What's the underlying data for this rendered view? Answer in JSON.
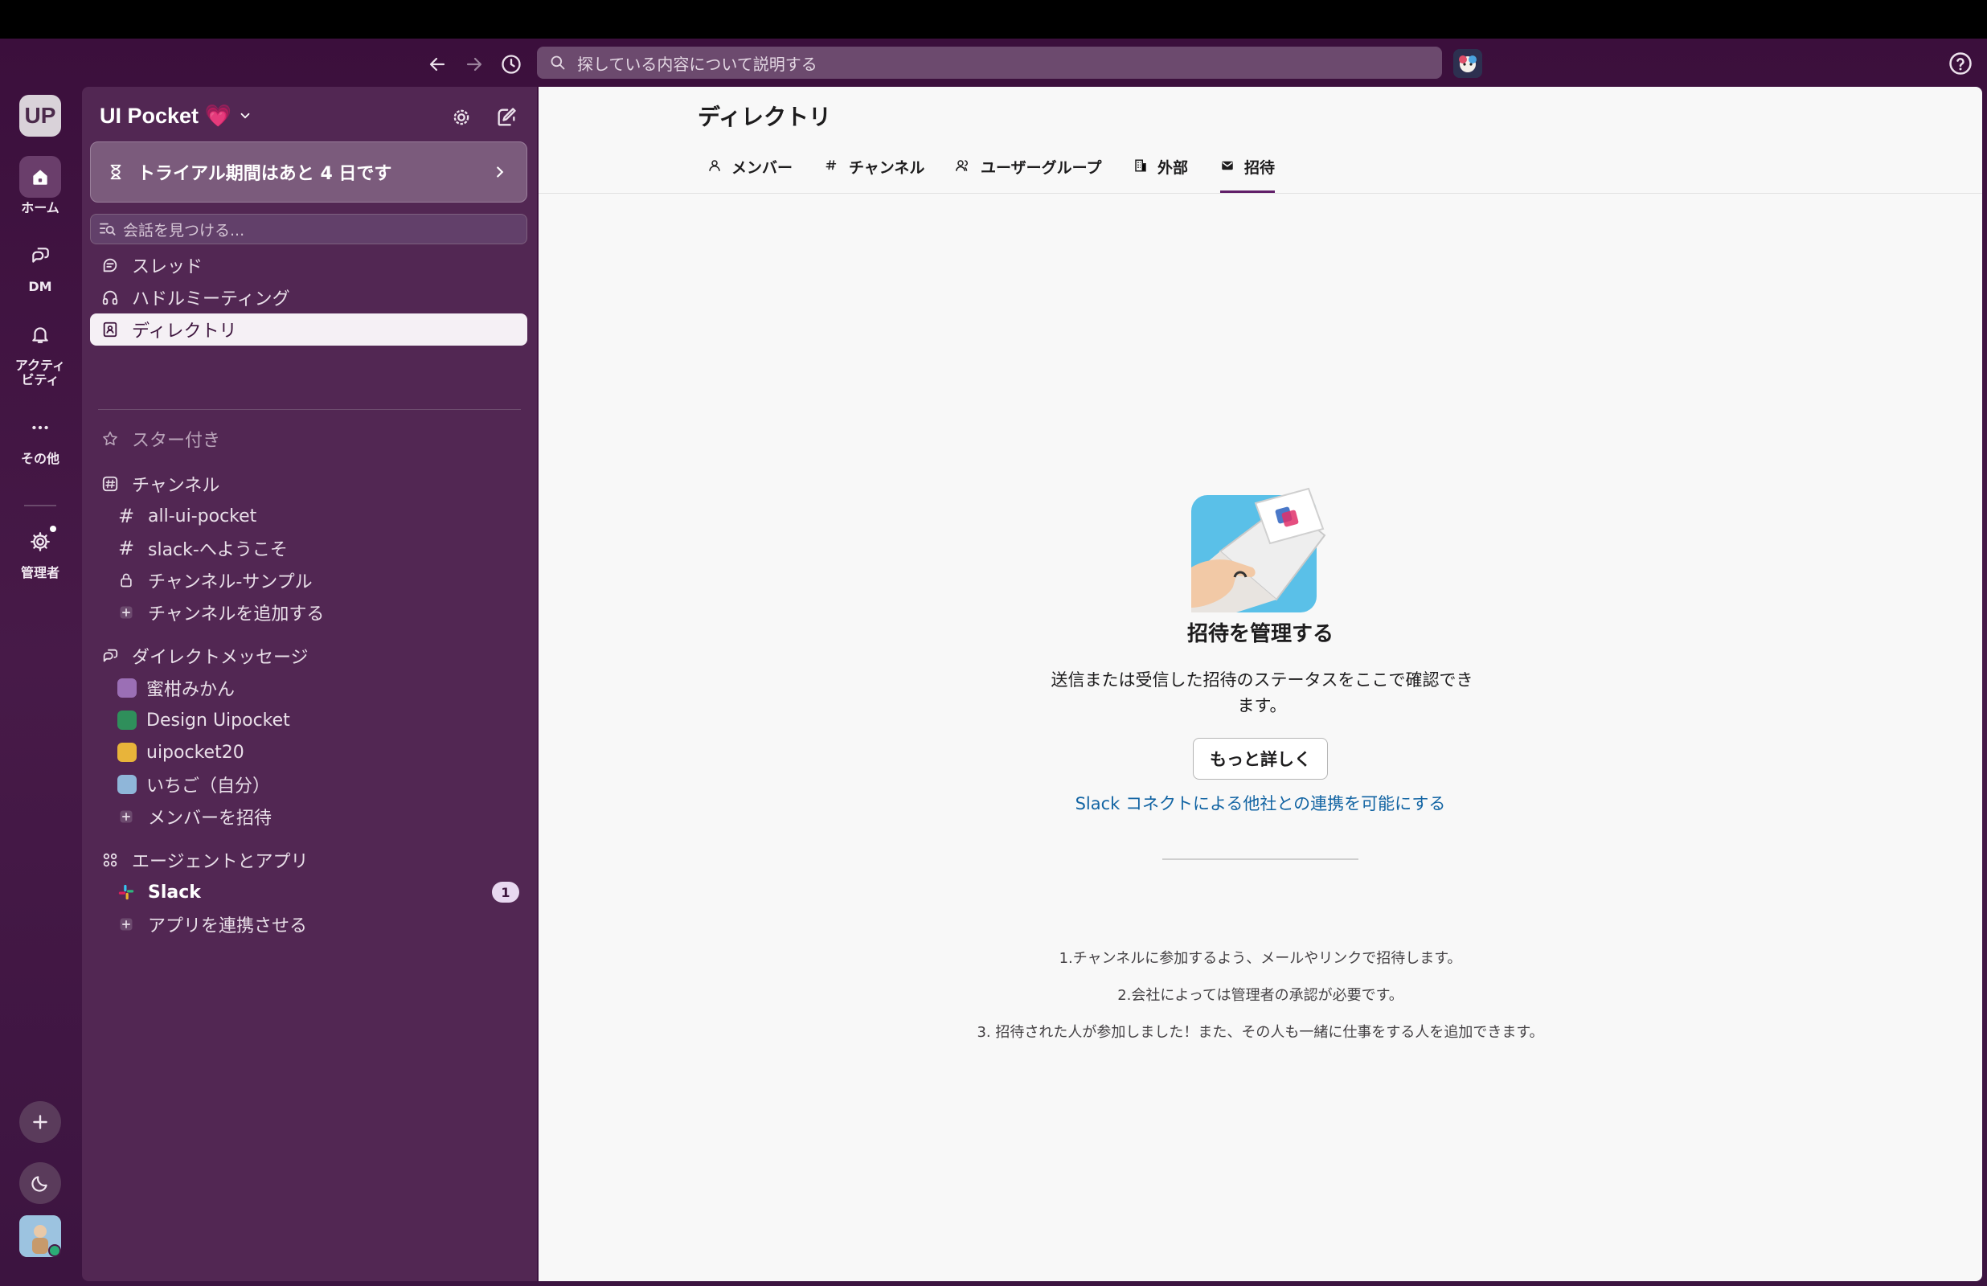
{
  "toolbar": {
    "search_placeholder": "探している内容について説明する"
  },
  "rail": {
    "workspace_initials": "UP",
    "items": [
      {
        "label": "ホーム"
      },
      {
        "label": "DM"
      },
      {
        "label": "アクティ\nビティ"
      },
      {
        "label": "その他"
      },
      {
        "label": "管理者"
      }
    ]
  },
  "sidebar": {
    "workspace_name": "UI Pocket 💗",
    "trial_text": "トライアル期間はあと 4 日です",
    "find_placeholder": "会話を見つける...",
    "nav": {
      "threads": "スレッド",
      "huddles": "ハドルミーティング",
      "directory": "ディレクトリ"
    },
    "starred": "スター付き",
    "channels_header": "チャンネル",
    "channels": [
      "all-ui-pocket",
      "slack-へようこそ",
      "チャンネル-サンプル"
    ],
    "add_channel": "チャンネルを追加する",
    "dm_header": "ダイレクトメッセージ",
    "dms": [
      "蜜柑みかん",
      "Design Uipocket",
      "uipocket20",
      "いちご（自分）"
    ],
    "invite_members": "メンバーを招待",
    "apps_header": "エージェントとアプリ",
    "apps": [
      {
        "name": "Slack",
        "badge": "1"
      }
    ],
    "connect_app": "アプリを連携させる"
  },
  "main": {
    "title": "ディレクトリ",
    "tabs": [
      {
        "label": "メンバー"
      },
      {
        "label": "チャンネル"
      },
      {
        "label": "ユーザーグループ"
      },
      {
        "label": "外部"
      },
      {
        "label": "招待"
      }
    ],
    "active_tab": "招待",
    "empty_title": "招待を管理する",
    "empty_desc": "送信または受信した招待のステータスをここで確認できます。",
    "learn_more": "もっと詳しく",
    "connect_link": "Slack コネクトによる他社との連携を可能にする",
    "steps": [
      "1.チャンネルに参加するよう、メールやリンクで招待します。",
      "2.会社によっては管理者の承認が必要です。",
      "3. 招待された人が参加しました！また、その人も一緒に仕事をする人を追加できます。"
    ]
  },
  "colors": {
    "sidebar_bg": "#522753",
    "accent": "#611f69",
    "link": "#1264a3"
  }
}
